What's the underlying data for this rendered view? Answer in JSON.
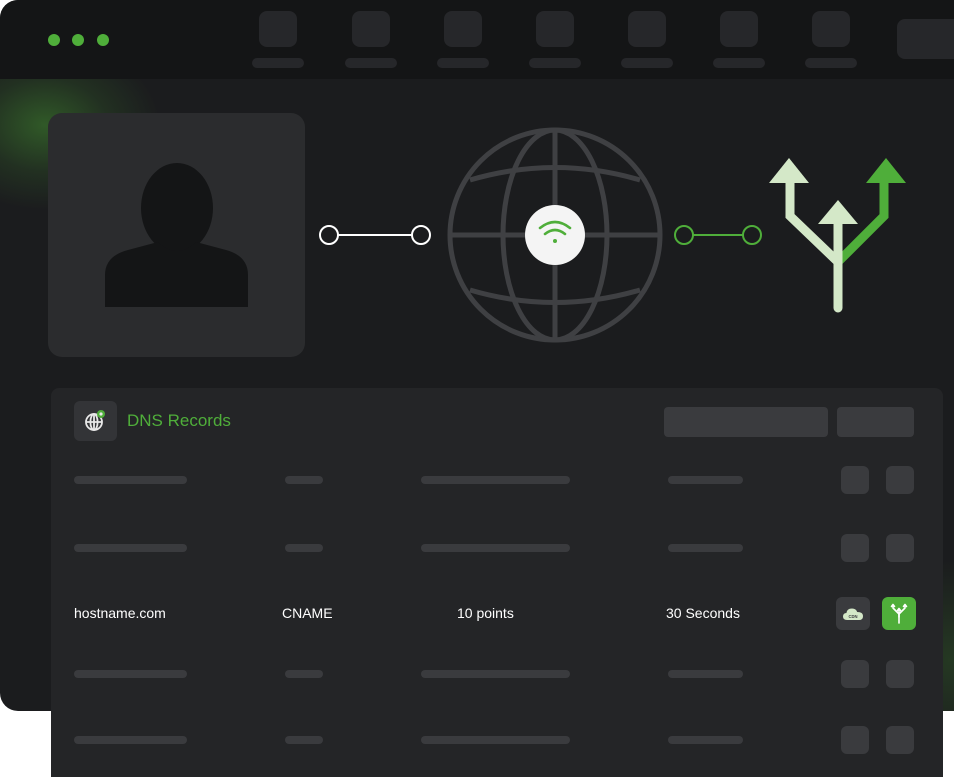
{
  "window": {
    "control_dots": 3,
    "toolbar_placeholder_count": 7
  },
  "diagram": {
    "user_icon": "user-silhouette-icon",
    "globe_icon": "globe-icon",
    "wifi_icon": "wifi-icon",
    "routing_icon": "split-arrows-icon",
    "colors": {
      "accent": "#4fae3a",
      "accent_light": "#d4e8c8",
      "globe": "#3f4043",
      "link_white": "#ffffff"
    }
  },
  "dns_panel": {
    "title": "DNS Records",
    "title_icon": "globe-badge-icon",
    "records": [
      {
        "placeholder": true
      },
      {
        "placeholder": true
      },
      {
        "placeholder": false,
        "hostname": "hostname.com",
        "type": "CNAME",
        "weight": "10 points",
        "ttl": "30 Seconds",
        "actions": [
          {
            "icon": "cdn-cloud-icon",
            "label": "CDN"
          },
          {
            "icon": "split-routing-icon"
          }
        ]
      },
      {
        "placeholder": true
      },
      {
        "placeholder": true
      }
    ]
  }
}
